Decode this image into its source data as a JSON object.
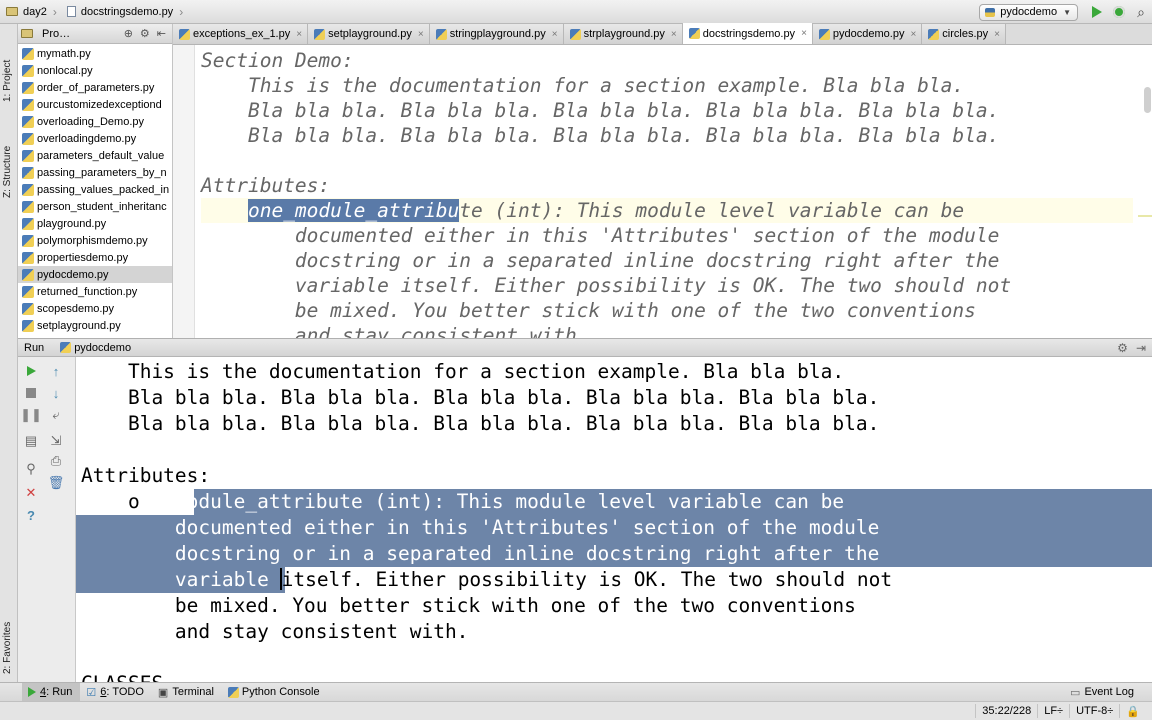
{
  "navbar": {
    "breadcrumbs": [
      "day2",
      "docstringsdemo.py"
    ],
    "run_config": "pydocdemo"
  },
  "left_stripe": {
    "project_tab": "1: Project",
    "structure_tab": "Z: Structure",
    "favorites_tab": "2: Favorites"
  },
  "project": {
    "title": "Pro…",
    "files": [
      "mymath.py",
      "nonlocal.py",
      "order_of_parameters.py",
      "ourcustomizedexceptiond",
      "overloading_Demo.py",
      "overloadingdemo.py",
      "parameters_default_value",
      "passing_parameters_by_n",
      "passing_values_packed_in",
      "person_student_inheritanc",
      "playground.py",
      "polymorphismdemo.py",
      "propertiesdemo.py",
      "pydocdemo.py",
      "returned_function.py",
      "scopesdemo.py",
      "setplayground.py"
    ],
    "selected_index": 13
  },
  "tabs": [
    {
      "label": "exceptions_ex_1.py",
      "active": false
    },
    {
      "label": "setplayground.py",
      "active": false
    },
    {
      "label": "stringplayground.py",
      "active": false
    },
    {
      "label": "strplayground.py",
      "active": false
    },
    {
      "label": "docstringsdemo.py",
      "active": true
    },
    {
      "label": "pydocdemo.py",
      "active": false
    },
    {
      "label": "circles.py",
      "active": false
    }
  ],
  "editor": {
    "lines": [
      "Section Demo:",
      "    This is the documentation for a section example. Bla bla bla.",
      "    Bla bla bla. Bla bla bla. Bla bla bla. Bla bla bla. Bla bla bla.",
      "    Bla bla bla. Bla bla bla. Bla bla bla. Bla bla bla. Bla bla bla.",
      "",
      "Attributes:",
      "    ",
      "        documented either in this 'Attributes' section of the module",
      "        docstring or in a separated inline docstring right after the",
      "        variable itself. Either possibility is OK. The two should not",
      "        be mixed. You better stick with one of the two conventions",
      "        and stay consistent with."
    ],
    "attr_highlight": "one_module_attribu",
    "attr_rest": "te (int): This module level variable can be"
  },
  "run_panel": {
    "label": "Run",
    "config": "pydocdemo"
  },
  "console": {
    "lines": [
      "    This is the documentation for a section example. Bla bla bla.",
      "    Bla bla bla. Bla bla bla. Bla bla bla. Bla bla bla. Bla bla bla.",
      "    Bla bla bla. Bla bla bla. Bla bla bla. Bla bla bla. Bla bla bla.",
      "",
      "Attributes:"
    ],
    "attr_prefix": "    o",
    "attr_selected": "ne_module_attribute (int): This module level variable can be",
    "sel_line2": "        documented either in this 'Attributes' section of the module",
    "sel_line3": "        docstring or in a separated inline docstring right after the",
    "sel_line4_selected": "        variable ",
    "sel_line4_rest": "itself. Either possibility is OK. The two should not",
    "after_lines": [
      "        be mixed. You better stick with one of the two conventions",
      "        and stay consistent with.",
      "",
      "CLASSES"
    ]
  },
  "bottom_bar": {
    "run_num": "4",
    "run_label": ": Run",
    "todo_num": "6",
    "todo_label": ": TODO",
    "terminal": "Terminal",
    "python_console": "Python Console",
    "event_log": "Event Log"
  },
  "status": {
    "position": "35:22/228",
    "line_sep": "LF÷",
    "encoding": "UTF-8÷"
  }
}
